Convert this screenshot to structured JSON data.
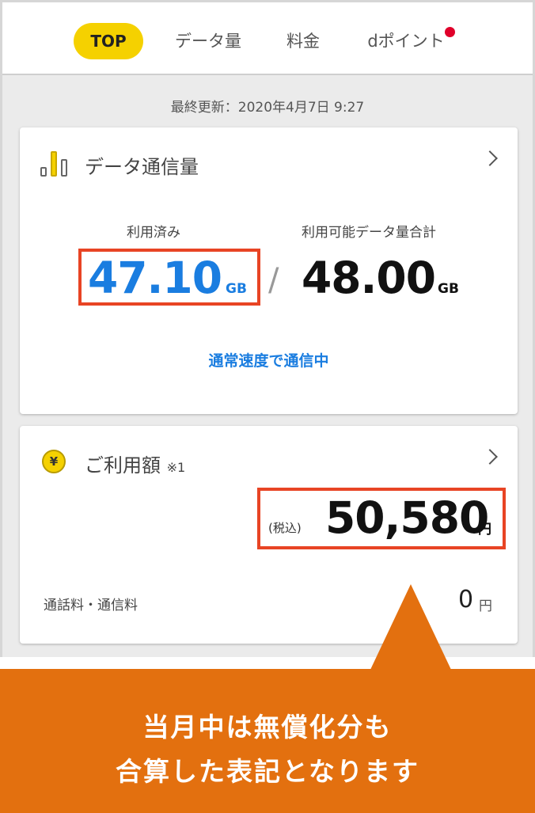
{
  "tabs": [
    {
      "label": "TOP",
      "active": true
    },
    {
      "label": "データ量",
      "active": false
    },
    {
      "label": "料金",
      "active": false
    },
    {
      "label": "dポイント",
      "active": false,
      "badge": true
    }
  ],
  "last_updated": "最終更新：2020年4月7日 9:27",
  "data_card": {
    "title": "データ通信量",
    "used_label": "利用済み",
    "used_value": "47.10",
    "used_unit": "GB",
    "separator": "/",
    "total_label": "利用可能データ量合計",
    "total_value": "48.00",
    "total_unit": "GB",
    "status": "通常速度で通信中"
  },
  "billing_card": {
    "title": "ご利用額",
    "note": "※1",
    "currency_symbol": "¥",
    "tax_label": "(税込)",
    "amount": "50,580",
    "amount_unit": "円",
    "row_label": "通話料・通信料",
    "row_value": "0",
    "row_unit": "円"
  },
  "callout": {
    "line1": "当月中は無償化分も",
    "line2": "合算した表記となります"
  },
  "colors": {
    "accent_yellow": "#f5d100",
    "used_blue": "#1a7de0",
    "highlight_red": "#e84424",
    "callout_orange": "#e3700f",
    "badge_red": "#e0002a"
  }
}
